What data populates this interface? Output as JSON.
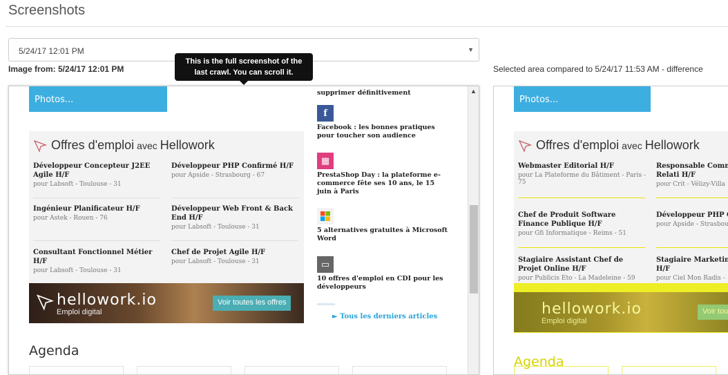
{
  "page": {
    "title": "Screenshots"
  },
  "select": {
    "value": "5/24/17 12:01 PM"
  },
  "labels": {
    "image_from": "Image from: 5/24/17 12:01 PM",
    "compared": "Selected area compared to 5/24/17 11:53 AM - difference"
  },
  "tooltip": {
    "text": "This is the full screenshot of the last crawl. You can scroll it."
  },
  "left": {
    "blue_box": "Photos...",
    "jobs": {
      "title": "Offres d'emploi",
      "avec": "avec",
      "brand": "Hellowork",
      "items": [
        {
          "title": "Développeur Concepteur J2EE Agile H/F",
          "company": "pour Labsoft - Toulouse - 31"
        },
        {
          "title": "Développeur PHP Confirmé H/F",
          "company": "pour Apside - Strasbourg - 67"
        },
        {
          "title": "Ingénieur Planificateur H/F",
          "company": "pour Astek - Rouen - 76"
        },
        {
          "title": "Développeur Web Front & Back End H/F",
          "company": "pour Labsoft - Toulouse - 31"
        },
        {
          "title": "Consultant Fonctionnel Métier H/F",
          "company": "pour Labsoft - Toulouse - 31"
        },
        {
          "title": "Chef de Projet Agile H/F",
          "company": "pour Labsoft - Toulouse - 31"
        }
      ]
    },
    "banner": {
      "logo": "hellowork.io",
      "sub": "Emploi digital",
      "button": "Voir toutes les offres"
    },
    "side": {
      "top_text": "supprimer définitivement",
      "items": [
        {
          "icon": "f",
          "text": "Facebook : les bonnes pratiques pour toucher son audience"
        },
        {
          "icon": "▦",
          "text": "PrestaShop Day : la plateforme e-commerce fête ses 10 ans, le 15 juin à Paris"
        },
        {
          "icon": "",
          "text": "5 alternatives gratuites à Microsoft Word"
        },
        {
          "icon": "▭",
          "text": "10 offres d'emploi en CDI pour les développeurs"
        }
      ],
      "link": "Tous les derniers articles"
    },
    "agenda": "Agenda"
  },
  "right": {
    "blue_box": "Photos...",
    "jobs_title": "Offres d'emploi",
    "jobs_avec": "avec",
    "jobs_brand": "Hellowork",
    "col1": [
      {
        "title": "Webmaster Editorial H/F",
        "company": "pour La Plateforme du Bâtiment - Paris - 75"
      },
      {
        "title": "Chef de Produit Software Finance Publique H/F",
        "company": "pour Gfi Informatique - Reims - 51"
      },
      {
        "title": "Stagiaire Assistant Chef de Projet Online H/F",
        "company": "pour Publicis Eto - La Madeleine - 59"
      }
    ],
    "col2": [
      {
        "title": "Responsable Comm Corporate et Relati H/F",
        "company": "pour Crit - Vélizy-Villa"
      },
      {
        "title": "Développeur PHP C",
        "company": "pour Apside - Strasbou"
      },
      {
        "title": "Stagiaire Marketin Commerce H/F",
        "company": "pour Ciel Mon Radis -"
      }
    ],
    "banner_logo": "hellowork.io",
    "banner_sub": "Emploi digital",
    "banner_button": "Voir tou",
    "agenda": "Agenda"
  },
  "colors": {
    "accent_blue": "#3daee0",
    "diff_yellow": "#ebeb00",
    "tooltip_bg": "#111111"
  }
}
